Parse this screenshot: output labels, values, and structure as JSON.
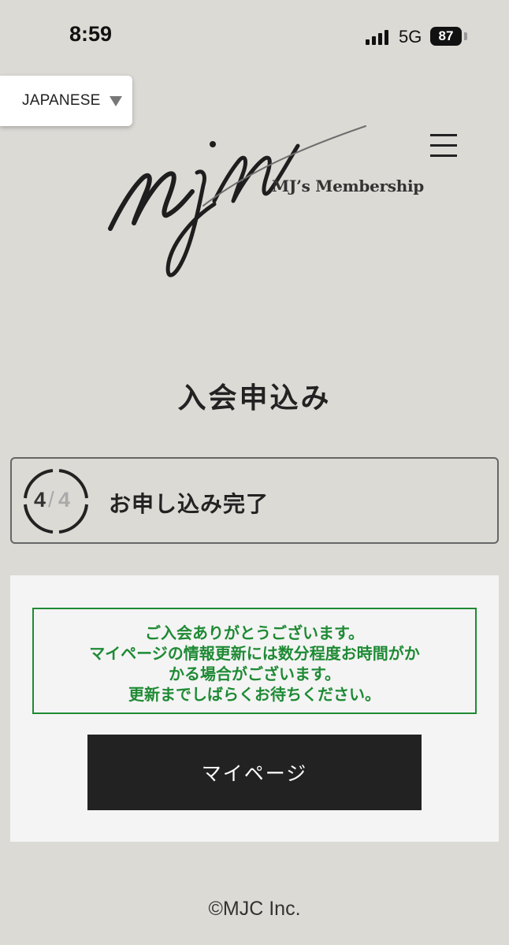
{
  "status_bar": {
    "time": "8:59",
    "network": "5G",
    "battery": "87"
  },
  "language": {
    "selected": "JAPANESE"
  },
  "logo": {
    "mark": "mjm",
    "subtitle": "MJ’s Membership"
  },
  "page": {
    "title": "入会申込み"
  },
  "step": {
    "current": "4",
    "separator": "/",
    "total": "4",
    "label": "お申し込み完了"
  },
  "notice": {
    "lines": [
      "ご入会ありがとうございます。",
      "マイページの情報更新には数分程度お時間がか",
      "かる場合がございます。",
      "更新までしばらくお待ちください。"
    ],
    "color": "#1e8a34"
  },
  "actions": {
    "mypage_label": "マイページ"
  },
  "footer": {
    "copyright": "©MJC Inc."
  }
}
